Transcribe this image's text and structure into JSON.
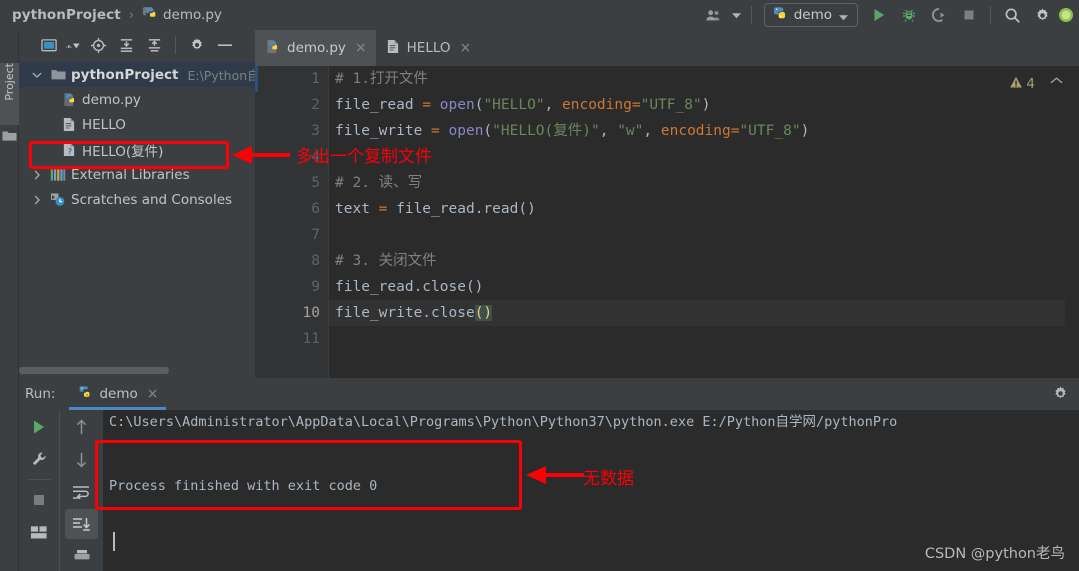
{
  "window": {
    "breadcrumb": {
      "project": "pythonProject",
      "separator": "›",
      "file": "demo.py"
    }
  },
  "toolbar": {
    "run_config_name": "demo",
    "icons": {
      "people": "people-icon",
      "dropdown": "chevron-down-icon",
      "python": "python-icon",
      "run": "run-icon",
      "debug": "debug-icon",
      "run_coverage": "run-with-coverage-icon",
      "stop": "stop-icon",
      "search": "search-icon",
      "settings": "gear-icon"
    }
  },
  "sidebar": {
    "vertical_tab": "Project",
    "toolbar_icons": [
      "select-opened-file-icon",
      "view-options-dropdown-icon",
      "locate-icon",
      "expand-all-icon",
      "collapse-all-icon",
      "gear-icon",
      "hide-icon"
    ],
    "tree": [
      {
        "label": "pythonProject",
        "sub": "E:\\Python自",
        "icon": "folder-icon",
        "twisty": "expanded",
        "depth": 0,
        "bold": true,
        "selected": true
      },
      {
        "label": "demo.py",
        "sub": "",
        "icon": "python-file-icon",
        "twisty": "none",
        "depth": 1,
        "bold": false,
        "selected": false
      },
      {
        "label": "HELLO",
        "sub": "",
        "icon": "text-file-icon",
        "twisty": "none",
        "depth": 1,
        "bold": false,
        "selected": false
      },
      {
        "label": "HELLO(复件)",
        "sub": "",
        "icon": "unknown-file-icon",
        "twisty": "none",
        "depth": 1,
        "bold": false,
        "selected": false
      },
      {
        "label": "External Libraries",
        "sub": "",
        "icon": "libraries-icon",
        "twisty": "collapsed",
        "depth": 0,
        "bold": false,
        "selected": false
      },
      {
        "label": "Scratches and Consoles",
        "sub": "",
        "icon": "scratches-icon",
        "twisty": "collapsed",
        "depth": 0,
        "bold": false,
        "selected": false
      }
    ]
  },
  "editor": {
    "tabs": [
      {
        "label": "demo.py",
        "icon": "python-file-icon",
        "active": true
      },
      {
        "label": "HELLO",
        "icon": "text-file-icon",
        "active": false
      }
    ],
    "close_glyph": "×",
    "warning_count": "4",
    "warning_icon": "warning-triangle-icon",
    "collapse_glyph": "⌃",
    "line_numbers": [
      "1",
      "2",
      "3",
      "4",
      "5",
      "6",
      "7",
      "8",
      "9",
      "10",
      "11"
    ],
    "current_line": 10,
    "lines": [
      {
        "n": "1",
        "tokens": [
          {
            "t": "# 1.打开文件",
            "c": "c-com"
          }
        ]
      },
      {
        "n": "2",
        "tokens": [
          {
            "t": "file_read ",
            "c": "c-id"
          },
          {
            "t": "=",
            "c": "c-kw"
          },
          {
            "t": " ",
            "c": "c-id"
          },
          {
            "t": "open",
            "c": "c-fn"
          },
          {
            "t": "(",
            "c": "c-par"
          },
          {
            "t": "\"HELLO\"",
            "c": "c-str"
          },
          {
            "t": ", ",
            "c": "c-par"
          },
          {
            "t": "encoding",
            "c": "c-kw"
          },
          {
            "t": "=",
            "c": "c-kw"
          },
          {
            "t": "\"UTF_8\"",
            "c": "c-str"
          },
          {
            "t": ")",
            "c": "c-par"
          }
        ]
      },
      {
        "n": "3",
        "tokens": [
          {
            "t": "file_write ",
            "c": "c-id"
          },
          {
            "t": "=",
            "c": "c-kw"
          },
          {
            "t": " ",
            "c": "c-id"
          },
          {
            "t": "open",
            "c": "c-fn"
          },
          {
            "t": "(",
            "c": "c-par"
          },
          {
            "t": "\"HELLO(复件)\"",
            "c": "c-str"
          },
          {
            "t": ", ",
            "c": "c-par"
          },
          {
            "t": "\"w\"",
            "c": "c-str"
          },
          {
            "t": ", ",
            "c": "c-par"
          },
          {
            "t": "encoding",
            "c": "c-kw"
          },
          {
            "t": "=",
            "c": "c-kw"
          },
          {
            "t": "\"UTF_8\"",
            "c": "c-str"
          },
          {
            "t": ")",
            "c": "c-par"
          }
        ]
      },
      {
        "n": "4",
        "tokens": [
          {
            "t": "",
            "c": "c-id"
          }
        ]
      },
      {
        "n": "5",
        "tokens": [
          {
            "t": "# 2. 读、写",
            "c": "c-com"
          }
        ]
      },
      {
        "n": "6",
        "tokens": [
          {
            "t": "text ",
            "c": "c-id"
          },
          {
            "t": "=",
            "c": "c-kw"
          },
          {
            "t": " file_read.read()",
            "c": "c-id"
          }
        ]
      },
      {
        "n": "7",
        "tokens": [
          {
            "t": "",
            "c": "c-id"
          }
        ]
      },
      {
        "n": "8",
        "tokens": [
          {
            "t": "# 3. 关闭文件",
            "c": "c-com"
          }
        ]
      },
      {
        "n": "9",
        "tokens": [
          {
            "t": "file_read.close()",
            "c": "c-id"
          }
        ]
      },
      {
        "n": "10",
        "tokens": [
          {
            "t": "file_write.close",
            "c": "c-id"
          },
          {
            "t": "()",
            "c": "brace-hl"
          }
        ]
      },
      {
        "n": "11",
        "tokens": [
          {
            "t": "",
            "c": "c-id"
          }
        ]
      }
    ]
  },
  "run_panel": {
    "label": "Run:",
    "tab_name": "demo",
    "tab_icon": "python-icon",
    "close_glyph": "×",
    "gear_icon": "gear-icon",
    "left_buttons": [
      "rerun-icon",
      "wrench-icon",
      "stop-icon",
      "layout-icon"
    ],
    "right_buttons": [
      "up-arrow-icon",
      "down-arrow-icon",
      "soft-wrap-icon",
      "scroll-to-end-icon",
      "print-icon"
    ],
    "console": [
      "C:\\Users\\Administrator\\AppData\\Local\\Programs\\Python\\Python37\\python.exe E:/Python自学网/pythonPro",
      "",
      "Process finished with exit code 0"
    ]
  },
  "annotations": {
    "color": "#fb0007",
    "tree_note": "多出一个复制文件",
    "console_note": "无数据"
  },
  "watermark": "CSDN @python老鸟"
}
